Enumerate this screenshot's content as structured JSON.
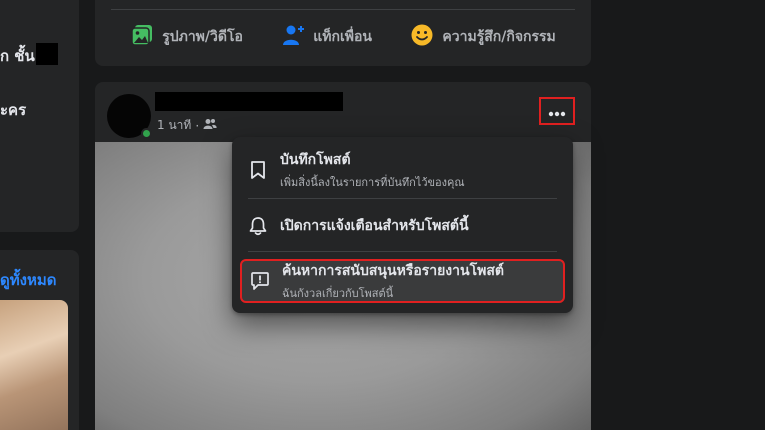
{
  "left": {
    "line1": "ก ชั้น",
    "line2": "ะคร",
    "see_all": "ดูทั้งหมด"
  },
  "composer": {
    "actions": [
      {
        "label": "รูปภาพ/วิดีโอ",
        "icon": "photo-icon",
        "color": "#45bd62"
      },
      {
        "label": "แท็กเพื่อน",
        "icon": "tag-friend-icon",
        "color": "#1877f2"
      },
      {
        "label": "ความรู้สึก/กิจกรรม",
        "icon": "feeling-icon",
        "color": "#f7b928"
      }
    ]
  },
  "post": {
    "time": "1 นาที",
    "separator": "·",
    "audience_icon": "friends-icon"
  },
  "menu": {
    "items": [
      {
        "title": "บันทึกโพสต์",
        "subtitle": "เพิ่มสิ่งนี้ลงในรายการที่บันทึกไว้ของคุณ",
        "icon": "bookmark-icon"
      },
      {
        "title": "เปิดการแจ้งเตือนสำหรับโพสต์นี้",
        "subtitle": "",
        "icon": "bell-icon"
      },
      {
        "title": "ค้นหาการสนับสนุนหรือรายงานโพสต์",
        "subtitle": "ฉันกังวลเกี่ยวกับโพสต์นี้",
        "icon": "report-icon"
      }
    ]
  },
  "colors": {
    "background": "#18191a",
    "card": "#242526",
    "highlight_outline": "#e02020",
    "link": "#2d88ff"
  }
}
